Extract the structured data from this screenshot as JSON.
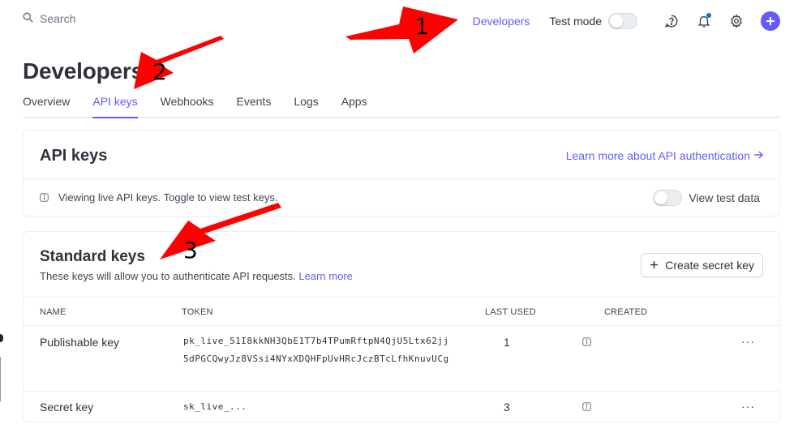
{
  "topbar": {
    "search_placeholder": "Search",
    "developers_link": "Developers",
    "test_mode_label": "Test mode"
  },
  "page": {
    "title": "Developers",
    "tabs": [
      {
        "label": "Overview"
      },
      {
        "label": "API keys"
      },
      {
        "label": "Webhooks"
      },
      {
        "label": "Events"
      },
      {
        "label": "Logs"
      },
      {
        "label": "Apps"
      }
    ]
  },
  "api_keys_card": {
    "title": "API keys",
    "learn_more_link": "Learn more about API authentication",
    "notice": "Viewing live API keys. Toggle to view test keys.",
    "view_test_data_label": "View test data"
  },
  "standard_keys_card": {
    "title": "Standard keys",
    "subtitle": "These keys will allow you to authenticate API requests.",
    "learn_more_link": "Learn more",
    "create_button": "Create secret key",
    "columns": [
      "NAME",
      "TOKEN",
      "LAST USED",
      "CREATED"
    ],
    "rows": [
      {
        "name": "Publishable key",
        "token_line1": "pk_live_51I8kkNH3QbE1T7b4TPumRftpN4QjU5Ltx62jj",
        "token_line2": "5dPGCQwyJz8VSsi4NYxXDQHFpUvHRcJczBTcLfhKnuvUCg",
        "last_used": "1",
        "more": "···"
      },
      {
        "name": "Secret key",
        "token_line1": "sk_live_...",
        "last_used": "3",
        "more": "···"
      }
    ]
  },
  "annotations": [
    "1",
    "2",
    "3"
  ],
  "colors": {
    "accent": "#635bff",
    "text": "#30313d",
    "muted": "#6a7383",
    "border": "#ebeef1",
    "arrow": "#ff0000"
  },
  "icons": [
    "search-icon",
    "help-icon",
    "bell-icon",
    "gear-icon",
    "plus-icon",
    "info-icon",
    "arrow-right-icon"
  ]
}
